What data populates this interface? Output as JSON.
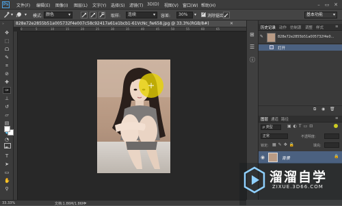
{
  "app": {
    "logo": "Ps",
    "window_controls": [
      "–",
      "▭",
      "✕"
    ]
  },
  "menubar": {
    "items": [
      "文件(F)",
      "编辑(E)",
      "图像(I)",
      "图层(L)",
      "文字(Y)",
      "选择(S)",
      "滤镜(T)",
      "3D(D)",
      "视图(V)",
      "窗口(W)",
      "帮助(H)"
    ]
  },
  "options": {
    "brush_size": "13",
    "mode_label": "模式:",
    "mode_value": "颜色",
    "sampling_label": "取样:",
    "sampling_value": "连续",
    "tolerance_label": "容差:",
    "tolerance_value": "30%",
    "antialias_label": "消除锯齿",
    "workspace_value": "基本功能"
  },
  "document": {
    "tab_title": "828e72e2855b51a005732f4e007c58c92417a61e1bcb1-61VcNc_fw658.jpg @ 33.3%(RGB/8#)",
    "ruler_ticks": [
      "0",
      "5",
      "10",
      "15",
      "20",
      "25",
      "30",
      "35",
      "40",
      "45",
      "50",
      "55",
      "60",
      "65"
    ]
  },
  "status": {
    "zoom": "33.33%",
    "doc_info": "文档:1.86M/1.86M"
  },
  "history_panel": {
    "tabs": [
      "历史记录",
      "动作",
      "仿制源",
      "调整",
      "样式"
    ],
    "snapshot_label": "828e72e2855b51a005732f4e0...",
    "items": [
      "打开"
    ]
  },
  "layers_panel": {
    "tabs": [
      "图层",
      "通道",
      "路径"
    ],
    "kind_label": "ρ 类型",
    "blend_value": "正常",
    "opacity_label": "不透明度:",
    "lock_label": "锁定:",
    "fill_label": "填充:",
    "layers": [
      {
        "name": "背景"
      }
    ]
  },
  "watermark": {
    "brand_cn": "溜溜自学",
    "url": "ZIXUE.3D66.COM"
  },
  "colors": {
    "accent": "#4ea6ea",
    "selected_row": "#4b6180",
    "brush_circle": "#e8d400"
  }
}
